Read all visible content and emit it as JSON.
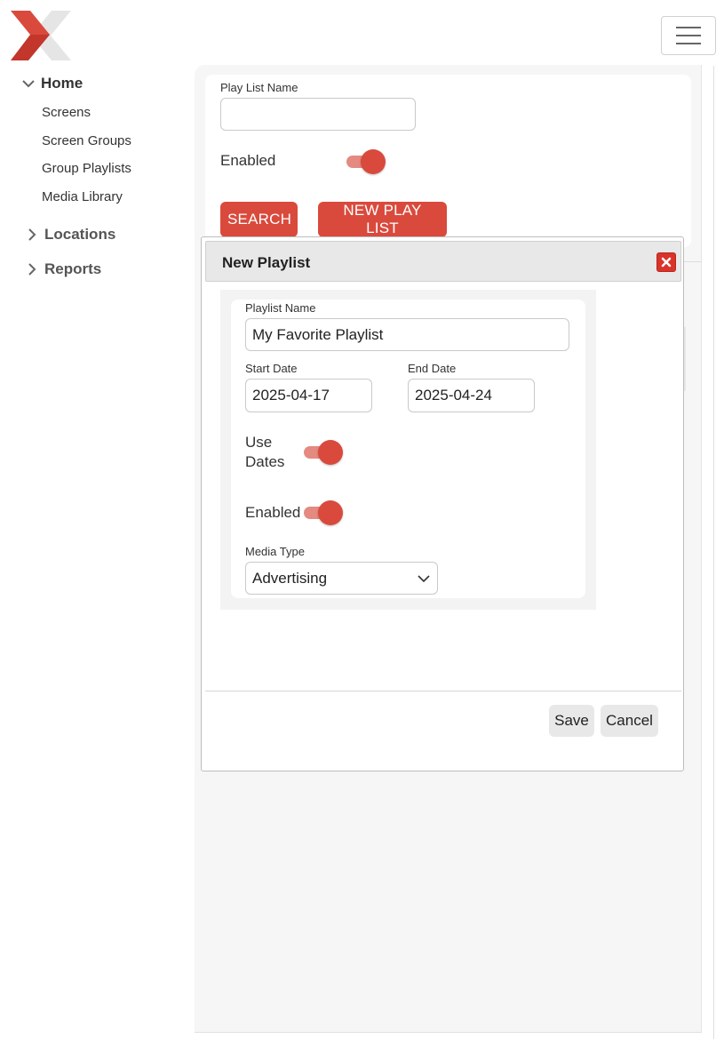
{
  "header": {
    "logo_icon": "x-logo-icon",
    "menu_icon": "hamburger-icon"
  },
  "sidebar": {
    "home": {
      "label": "Home",
      "expanded": true
    },
    "home_items": [
      {
        "label": "Screens"
      },
      {
        "label": "Screen Groups"
      },
      {
        "label": "Group Playlists"
      },
      {
        "label": "Media Library"
      }
    ],
    "locations": {
      "label": "Locations",
      "expanded": false
    },
    "reports": {
      "label": "Reports",
      "expanded": false
    }
  },
  "search_panel": {
    "name_label": "Play List Name",
    "name_value": "",
    "enabled_label": "Enabled",
    "enabled": true,
    "search_button": "SEARCH",
    "new_button": "NEW PLAY LIST"
  },
  "dialog": {
    "title": "New Playlist",
    "playlist_name_label": "Playlist Name",
    "playlist_name_value": "My Favorite Playlist",
    "start_date_label": "Start Date",
    "start_date_value": "2025-04-17",
    "end_date_label": "End Date",
    "end_date_value": "2025-04-24",
    "use_dates_label_1": "Use",
    "use_dates_label_2": "Dates",
    "use_dates": true,
    "enabled_label": "Enabled",
    "enabled": true,
    "media_type_label": "Media Type",
    "media_type_value": "Advertising",
    "save_button": "Save",
    "cancel_button": "Cancel"
  },
  "colors": {
    "accent": "#d94a3d",
    "toggle_track": "#e48a80",
    "close_button": "#d9332a",
    "panel_background": "#f6f6f6"
  }
}
